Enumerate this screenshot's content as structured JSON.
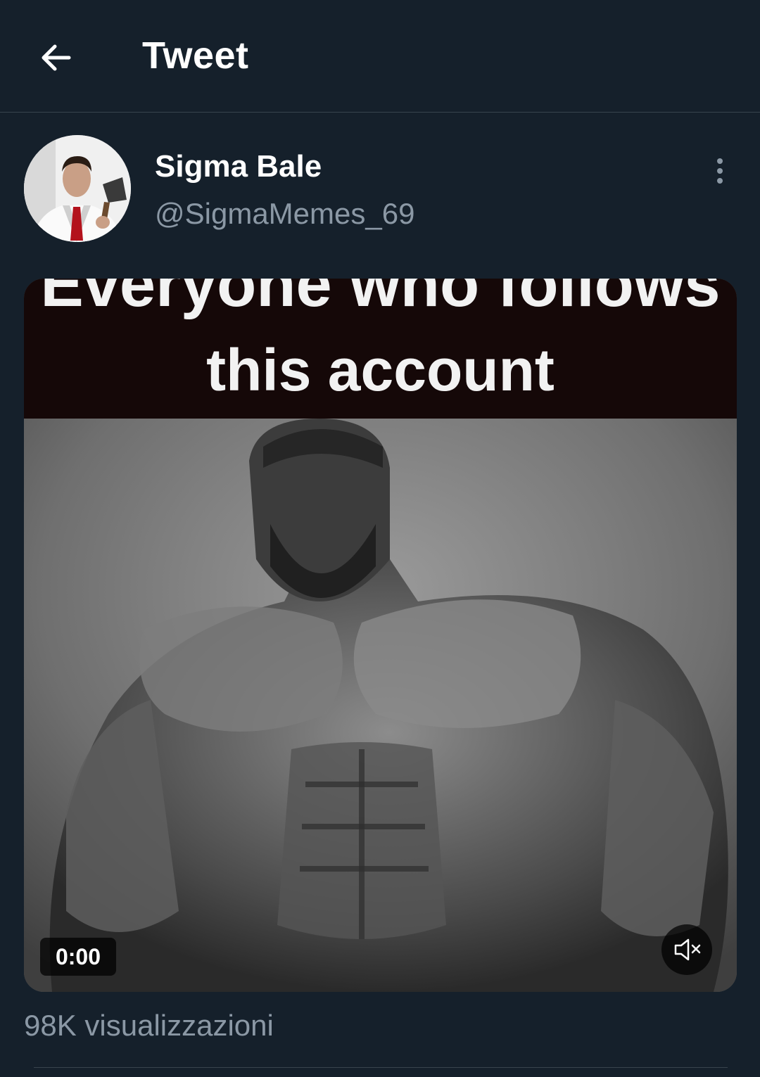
{
  "header": {
    "title": "Tweet",
    "back_icon": "arrow-left-icon"
  },
  "tweet": {
    "author": {
      "display_name": "Sigma Bale",
      "handle": "@SigmaMemes_69",
      "avatar": "avatar-photo"
    },
    "more_icon": "more-vertical-icon",
    "media": {
      "caption_line1": "Everyone who follows",
      "caption_line2": "this account",
      "time": "0:00",
      "mute_icon": "volume-muted-icon"
    },
    "views": "98K visualizzazioni"
  },
  "colors": {
    "background": "#15202b",
    "divider": "#38444d",
    "secondary_text": "#8b98a5",
    "primary_text": "#ffffff"
  }
}
